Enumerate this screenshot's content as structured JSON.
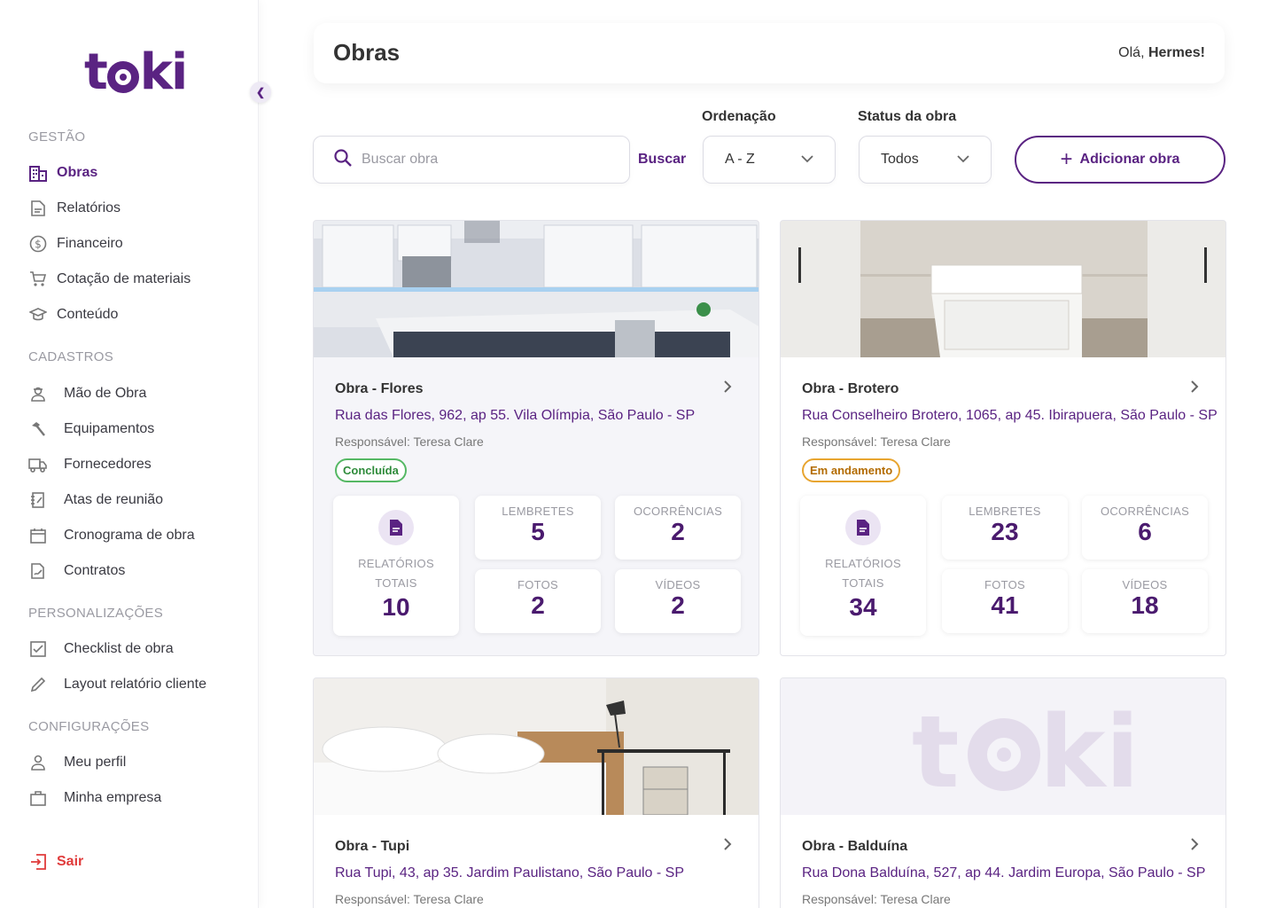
{
  "app": {
    "logo_text_left": "t",
    "logo_text_right": "ki",
    "collapse_icon": "chevron-left-icon"
  },
  "sidebar": {
    "sections": [
      "GESTÃO",
      "CADASTROS",
      "PERSONALIZAÇÕES",
      "CONFIGURAÇÕES"
    ],
    "gestao": [
      {
        "label": "Obras",
        "icon": "building-icon",
        "active": true
      },
      {
        "label": "Relatórios",
        "icon": "document-icon"
      },
      {
        "label": "Financeiro",
        "icon": "dollar-icon"
      },
      {
        "label": "Cotação de materiais",
        "icon": "cart-icon"
      },
      {
        "label": "Conteúdo",
        "icon": "graduation-cap-icon"
      }
    ],
    "cadastros": [
      {
        "label": "Mão de Obra",
        "icon": "worker-icon"
      },
      {
        "label": "Equipamentos",
        "icon": "hammer-icon"
      },
      {
        "label": "Fornecedores",
        "icon": "truck-icon"
      },
      {
        "label": "Atas de reunião",
        "icon": "notebook-icon"
      },
      {
        "label": "Cronograma de obra",
        "icon": "calendar-icon"
      },
      {
        "label": "Contratos",
        "icon": "contract-icon"
      }
    ],
    "personalizacoes": [
      {
        "label": "Checklist de obra",
        "icon": "checkbox-icon"
      },
      {
        "label": "Layout relatório cliente",
        "icon": "pencil-icon"
      }
    ],
    "configuracoes": [
      {
        "label": "Meu perfil",
        "icon": "user-icon"
      },
      {
        "label": "Minha empresa",
        "icon": "briefcase-icon"
      }
    ],
    "logout": "Sair"
  },
  "header": {
    "title": "Obras",
    "greeting_prefix": "Olá, ",
    "user_name": "Hermes!"
  },
  "filters": {
    "search_placeholder": "Buscar obra",
    "search_button": "Buscar",
    "sort_label": "Ordenação",
    "sort_value": "A - Z",
    "status_label": "Status da obra",
    "status_value": "Todos",
    "add_button": "Adicionar obra",
    "add_icon": "+"
  },
  "stat_labels": {
    "reports": [
      "RELATÓRIOS",
      "TOTAIS"
    ],
    "reminders": "LEMBRETES",
    "occurrences": "OCORRÊNCIAS",
    "photos": "FOTOS",
    "videos": "VÍDEOS"
  },
  "cards": [
    {
      "title": "Obra - Flores",
      "address": "Rua das Flores, 962, ap 55. Vila Olímpia, São Paulo - SP",
      "responsible": "Responsável: Teresa Clare",
      "status": "Concluída",
      "reports": "10",
      "reminders": "5",
      "occurrences": "2",
      "photos": "2",
      "videos": "2",
      "image": "kitchen-photo"
    },
    {
      "title": "Obra - Brotero",
      "address": "Rua Conselheiro Brotero, 1065, ap 45. Ibirapuera, São Paulo - SP",
      "responsible": "Responsável: Teresa Clare",
      "status": "Em andamento",
      "reports": "34",
      "reminders": "23",
      "occurrences": "6",
      "photos": "41",
      "videos": "18",
      "image": "closet-photo"
    },
    {
      "title": "Obra - Tupi",
      "address": "Rua Tupi, 43, ap 35. Jardim Paulistano, São Paulo - SP",
      "responsible": "Responsável: Teresa Clare",
      "image": "bedroom-photo"
    },
    {
      "title": "Obra - Balduína",
      "address": "Rua Dona Balduína, 527, ap 44. Jardim Europa, São Paulo - SP",
      "responsible": "Responsável: Teresa Clare",
      "image": "toki-placeholder-logo"
    }
  ],
  "colors": {
    "brand": "#5a2382",
    "success": "#2e8b3a",
    "warning": "#e8a530",
    "danger": "#e03b3b"
  }
}
